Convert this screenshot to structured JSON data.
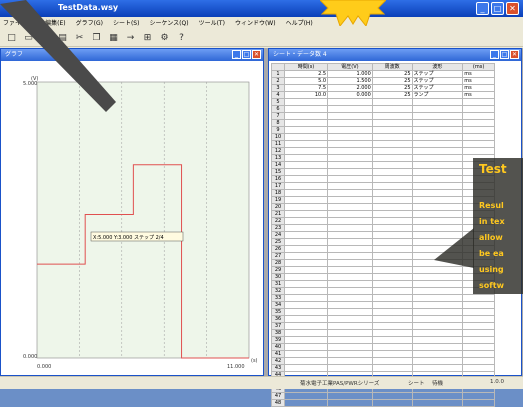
{
  "app": {
    "title": "TestData.wsy",
    "menus": [
      "ファイル(F)",
      "編集(E)",
      "グラフ(G)",
      "シート(S)",
      "シーケンス(Q)",
      "ツール(T)",
      "ウィンドウ(W)",
      "ヘルプ(H)"
    ],
    "toolbar_icons": [
      "new-file-icon",
      "open-folder-icon",
      "save-icon",
      "graph-icon",
      "cut-icon",
      "copy-icon",
      "paste-icon",
      "arrow-icon",
      "plot-icon",
      "settings-icon",
      "help-icon"
    ]
  },
  "graph_window": {
    "title": "グラフ",
    "y_axis_label": "(V)",
    "y_max_label": "5.000",
    "y_min_label": "0.000",
    "x_min_label": "0.000",
    "x_max_label": "11.000",
    "x_unit": "(s)",
    "tooltip": "X:5.000 Y:3.000 ステップ 2/4",
    "chart_data": {
      "type": "line",
      "x": [
        0,
        2.5,
        2.5,
        5,
        5,
        7.5,
        7.5,
        11
      ],
      "y": [
        1.7,
        1.7,
        2.6,
        2.6,
        3.5,
        3.5,
        0,
        0
      ],
      "xlim": [
        0,
        11
      ],
      "ylim": [
        0,
        5
      ],
      "grid": true,
      "color": "#e05050"
    }
  },
  "table_window": {
    "title": "シート・データ数 4",
    "headers": [
      "時間(s)",
      "電圧(V)",
      "周波数",
      "波形",
      "(ms)"
    ],
    "rows": [
      [
        "2.5",
        "1.000",
        "25",
        "ステップ",
        "ms"
      ],
      [
        "5.0",
        "1.500",
        "25",
        "ステップ",
        "ms"
      ],
      [
        "7.5",
        "2.000",
        "25",
        "ステップ",
        "ms"
      ],
      [
        "10.0",
        "0.000",
        "25",
        "ランプ",
        "ms"
      ]
    ],
    "row_numbers": [
      "1",
      "2",
      "3",
      "4",
      "5",
      "6",
      "7",
      "8",
      "9",
      "10",
      "11",
      "12",
      "13",
      "14",
      "15",
      "16",
      "17",
      "18",
      "19",
      "20",
      "21",
      "22",
      "23",
      "24",
      "25",
      "26",
      "27",
      "28",
      "29",
      "30",
      "31",
      "32",
      "33",
      "34",
      "35",
      "36",
      "37",
      "38",
      "39",
      "40",
      "41",
      "42",
      "43",
      "44",
      "45",
      "46",
      "47",
      "48"
    ]
  },
  "status_bar": {
    "text": "菊水電子工業PAS/PWRシリーズ",
    "mode": "シート",
    "state": "待機",
    "code": "1.0.0"
  },
  "callout": {
    "title": "Test",
    "body": [
      "Resul",
      "in tex",
      "allow",
      "be ea",
      "using",
      "softw"
    ]
  },
  "colors": {
    "accent": "#ffc81f",
    "titlebar": "#0a3fb8",
    "line": "#e05050"
  }
}
